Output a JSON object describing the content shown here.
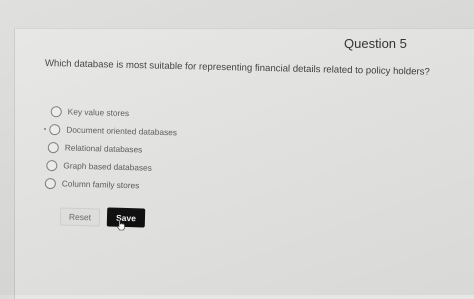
{
  "question": {
    "title": "Question 5",
    "text": "Which database is most suitable for representing financial details related to policy holders?"
  },
  "options": [
    {
      "label": "Key value stores"
    },
    {
      "label": "Document oriented databases"
    },
    {
      "label": "Relational databases"
    },
    {
      "label": "Graph based databases"
    },
    {
      "label": "Column family stores"
    }
  ],
  "buttons": {
    "reset_label": "Reset",
    "save_label": "Save"
  },
  "icons": {
    "cursor": "hand-pointer-icon",
    "radio": "radio-unchecked-icon"
  }
}
